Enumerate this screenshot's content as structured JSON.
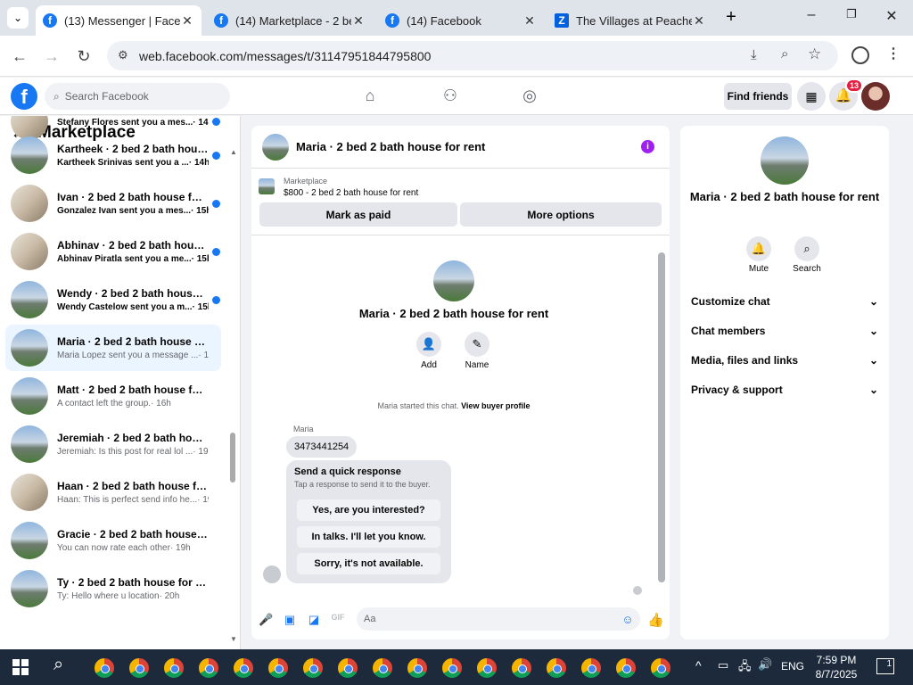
{
  "browser": {
    "tabs": [
      {
        "title": "(13) Messenger | Facebook",
        "active": true
      },
      {
        "title": "(14) Marketplace - 2 bed",
        "active": false
      },
      {
        "title": "(14) Facebook",
        "active": false
      },
      {
        "title": "The Villages at Peachers",
        "active": false
      }
    ],
    "url": "web.facebook.com/messages/t/31147951844795800"
  },
  "fb_header": {
    "search_placeholder": "Search Facebook",
    "find_friends": "Find friends",
    "notification_count": "13"
  },
  "sidebar": {
    "title": "Marketplace",
    "conversations": [
      {
        "title": "",
        "preview": "Stefany Flores sent you a mes...",
        "time": "· 14h",
        "unread": true
      },
      {
        "title": "Kartheek · 2 bed 2 bath house...",
        "preview": "Kartheek Srinivas sent you a ...",
        "time": "· 14h",
        "unread": true
      },
      {
        "title": "Ivan · 2 bed 2 bath house for ...",
        "preview": "Gonzalez Ivan sent you a mes...",
        "time": "· 15h",
        "unread": true
      },
      {
        "title": "Abhinav · 2 bed 2 bath house ...",
        "preview": "Abhinav Piratla sent you a me...",
        "time": "· 15h",
        "unread": true
      },
      {
        "title": "Wendy · 2 bed 2 bath house f...",
        "preview": "Wendy Castelow sent you a m...",
        "time": "· 15h",
        "unread": true
      },
      {
        "title": "Maria · 2 bed 2 bath house for r...",
        "preview": "Maria Lopez sent you a message ...",
        "time": "· 15h",
        "unread": false
      },
      {
        "title": "Matt · 2 bed 2 bath house for r...",
        "preview": "A contact left the group.",
        "time": "· 16h",
        "unread": false
      },
      {
        "title": "Jeremiah · 2 bed 2 bath house f...",
        "preview": "Jeremiah: Is this post for real lol ...",
        "time": "· 19h",
        "unread": false
      },
      {
        "title": "Haan · 2 bed 2 bath house for r...",
        "preview": "Haan: This is perfect send info he...",
        "time": "· 19h",
        "unread": false
      },
      {
        "title": "Gracie · 2 bed 2 bath house for ...",
        "preview": "You can now rate each other",
        "time": "· 19h",
        "unread": false
      },
      {
        "title": "Ty · 2 bed 2 bath house for rent",
        "preview": "Ty: Hello where u location",
        "time": "· 20h",
        "unread": false
      }
    ]
  },
  "chat": {
    "header_title": "Maria · 2 bed 2 bath house for rent",
    "marketplace_label": "Marketplace",
    "listing": "$800 - 2 bed 2 bath house for rent",
    "mark_paid": "Mark as paid",
    "more_options": "More options",
    "intro_name": "Maria · 2 bed 2 bath house for rent",
    "add_label": "Add",
    "name_label": "Name",
    "started_text": "Maria started this chat.",
    "view_buyer": "View buyer profile",
    "sender": "Maria",
    "message": "3473441254",
    "quick_title": "Send a quick response",
    "quick_sub": "Tap a response to send it to the buyer.",
    "quick_responses": [
      "Yes, are you interested?",
      "In talks. I'll let you know.",
      "Sorry, it's not available."
    ],
    "input_placeholder": "Aa"
  },
  "info": {
    "title": "Maria · 2 bed 2 bath house for rent",
    "mute": "Mute",
    "search": "Search",
    "sections": [
      "Customize chat",
      "Chat members",
      "Media, files and links",
      "Privacy & support"
    ]
  },
  "taskbar": {
    "lang": "ENG",
    "time": "7:59 PM",
    "date": "8/7/2025",
    "notif": "1"
  }
}
